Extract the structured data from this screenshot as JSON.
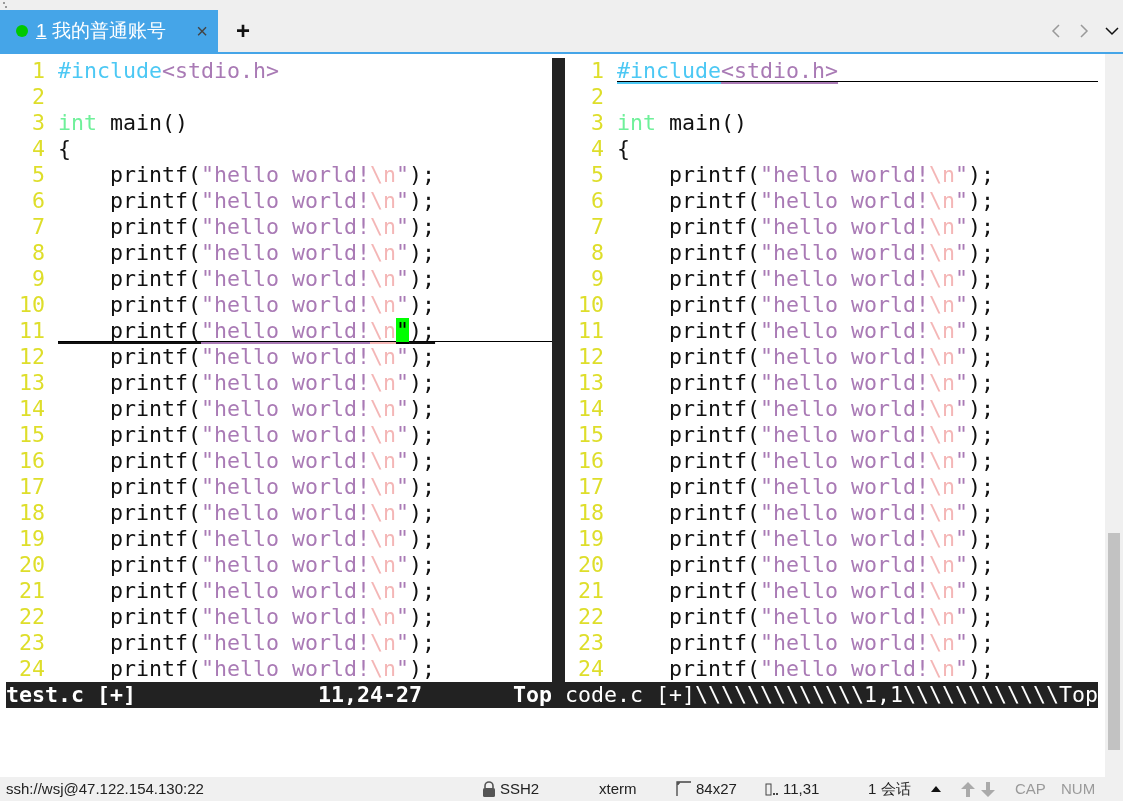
{
  "tabs": [
    {
      "number": "1",
      "label": "我的普通账号",
      "selected": true,
      "connected": true,
      "close": "×"
    }
  ],
  "new_tab": "+",
  "panes": [
    {
      "lines": [
        {
          "number": "1",
          "tokens": [
            {
              "kind": "preproc",
              "text": "#include"
            },
            {
              "kind": "string",
              "text": "<stdio.h>"
            }
          ]
        },
        {
          "number": "2"
        },
        {
          "number": "3",
          "tokens": [
            {
              "kind": "type",
              "text": "int"
            },
            {
              "kind": "plain",
              "text": " main()"
            }
          ]
        },
        {
          "number": "4",
          "tokens": [
            {
              "kind": "plain",
              "text": "{"
            }
          ]
        },
        {
          "number": "5",
          "tokens": [
            {
              "kind": "plain",
              "text": "    printf("
            },
            {
              "kind": "string",
              "text": "\"hello world!"
            },
            {
              "kind": "escape",
              "text": "\\n"
            },
            {
              "kind": "string",
              "text": "\""
            },
            {
              "kind": "plain",
              "text": ");"
            }
          ]
        },
        {
          "number": "6",
          "tokens": [
            {
              "kind": "plain",
              "text": "    printf("
            },
            {
              "kind": "string",
              "text": "\"hello world!"
            },
            {
              "kind": "escape",
              "text": "\\n"
            },
            {
              "kind": "string",
              "text": "\""
            },
            {
              "kind": "plain",
              "text": ");"
            }
          ]
        },
        {
          "number": "7",
          "tokens": [
            {
              "kind": "plain",
              "text": "    printf("
            },
            {
              "kind": "string",
              "text": "\"hello world!"
            },
            {
              "kind": "escape",
              "text": "\\n"
            },
            {
              "kind": "string",
              "text": "\""
            },
            {
              "kind": "plain",
              "text": ");"
            }
          ]
        },
        {
          "number": "8",
          "tokens": [
            {
              "kind": "plain",
              "text": "    printf("
            },
            {
              "kind": "string",
              "text": "\"hello world!"
            },
            {
              "kind": "escape",
              "text": "\\n"
            },
            {
              "kind": "string",
              "text": "\""
            },
            {
              "kind": "plain",
              "text": ");"
            }
          ]
        },
        {
          "number": "9",
          "tokens": [
            {
              "kind": "plain",
              "text": "    printf("
            },
            {
              "kind": "string",
              "text": "\"hello world!"
            },
            {
              "kind": "escape",
              "text": "\\n"
            },
            {
              "kind": "string",
              "text": "\""
            },
            {
              "kind": "plain",
              "text": ");"
            }
          ]
        },
        {
          "number": "10",
          "tokens": [
            {
              "kind": "plain",
              "text": "    printf("
            },
            {
              "kind": "string",
              "text": "\"hello world!"
            },
            {
              "kind": "escape",
              "text": "\\n"
            },
            {
              "kind": "string",
              "text": "\""
            },
            {
              "kind": "plain",
              "text": ");"
            }
          ]
        },
        {
          "number": "11",
          "cursor_line": true,
          "tokens": [
            {
              "kind": "plain",
              "text": "    printf("
            },
            {
              "kind": "string",
              "text": "\"hello world!"
            },
            {
              "kind": "escape",
              "text": "\\n"
            },
            {
              "kind": "string",
              "text": "\"",
              "cursor": true
            },
            {
              "kind": "plain",
              "text": ");"
            }
          ]
        },
        {
          "number": "12",
          "tokens": [
            {
              "kind": "plain",
              "text": "    printf("
            },
            {
              "kind": "string",
              "text": "\"hello world!"
            },
            {
              "kind": "escape",
              "text": "\\n"
            },
            {
              "kind": "string",
              "text": "\""
            },
            {
              "kind": "plain",
              "text": ");"
            }
          ]
        },
        {
          "number": "13",
          "tokens": [
            {
              "kind": "plain",
              "text": "    printf("
            },
            {
              "kind": "string",
              "text": "\"hello world!"
            },
            {
              "kind": "escape",
              "text": "\\n"
            },
            {
              "kind": "string",
              "text": "\""
            },
            {
              "kind": "plain",
              "text": ");"
            }
          ]
        },
        {
          "number": "14",
          "tokens": [
            {
              "kind": "plain",
              "text": "    printf("
            },
            {
              "kind": "string",
              "text": "\"hello world!"
            },
            {
              "kind": "escape",
              "text": "\\n"
            },
            {
              "kind": "string",
              "text": "\""
            },
            {
              "kind": "plain",
              "text": ");"
            }
          ]
        },
        {
          "number": "15",
          "tokens": [
            {
              "kind": "plain",
              "text": "    printf("
            },
            {
              "kind": "string",
              "text": "\"hello world!"
            },
            {
              "kind": "escape",
              "text": "\\n"
            },
            {
              "kind": "string",
              "text": "\""
            },
            {
              "kind": "plain",
              "text": ");"
            }
          ]
        },
        {
          "number": "16",
          "tokens": [
            {
              "kind": "plain",
              "text": "    printf("
            },
            {
              "kind": "string",
              "text": "\"hello world!"
            },
            {
              "kind": "escape",
              "text": "\\n"
            },
            {
              "kind": "string",
              "text": "\""
            },
            {
              "kind": "plain",
              "text": ");"
            }
          ]
        },
        {
          "number": "17",
          "tokens": [
            {
              "kind": "plain",
              "text": "    printf("
            },
            {
              "kind": "string",
              "text": "\"hello world!"
            },
            {
              "kind": "escape",
              "text": "\\n"
            },
            {
              "kind": "string",
              "text": "\""
            },
            {
              "kind": "plain",
              "text": ");"
            }
          ]
        },
        {
          "number": "18",
          "tokens": [
            {
              "kind": "plain",
              "text": "    printf("
            },
            {
              "kind": "string",
              "text": "\"hello world!"
            },
            {
              "kind": "escape",
              "text": "\\n"
            },
            {
              "kind": "string",
              "text": "\""
            },
            {
              "kind": "plain",
              "text": ");"
            }
          ]
        },
        {
          "number": "19",
          "tokens": [
            {
              "kind": "plain",
              "text": "    printf("
            },
            {
              "kind": "string",
              "text": "\"hello world!"
            },
            {
              "kind": "escape",
              "text": "\\n"
            },
            {
              "kind": "string",
              "text": "\""
            },
            {
              "kind": "plain",
              "text": ");"
            }
          ]
        },
        {
          "number": "20",
          "tokens": [
            {
              "kind": "plain",
              "text": "    printf("
            },
            {
              "kind": "string",
              "text": "\"hello world!"
            },
            {
              "kind": "escape",
              "text": "\\n"
            },
            {
              "kind": "string",
              "text": "\""
            },
            {
              "kind": "plain",
              "text": ");"
            }
          ]
        },
        {
          "number": "21",
          "tokens": [
            {
              "kind": "plain",
              "text": "    printf("
            },
            {
              "kind": "string",
              "text": "\"hello world!"
            },
            {
              "kind": "escape",
              "text": "\\n"
            },
            {
              "kind": "string",
              "text": "\""
            },
            {
              "kind": "plain",
              "text": ");"
            }
          ]
        },
        {
          "number": "22",
          "tokens": [
            {
              "kind": "plain",
              "text": "    printf("
            },
            {
              "kind": "string",
              "text": "\"hello world!"
            },
            {
              "kind": "escape",
              "text": "\\n"
            },
            {
              "kind": "string",
              "text": "\""
            },
            {
              "kind": "plain",
              "text": ");"
            }
          ]
        },
        {
          "number": "23",
          "tokens": [
            {
              "kind": "plain",
              "text": "    printf("
            },
            {
              "kind": "string",
              "text": "\"hello world!"
            },
            {
              "kind": "escape",
              "text": "\\n"
            },
            {
              "kind": "string",
              "text": "\""
            },
            {
              "kind": "plain",
              "text": ");"
            }
          ]
        },
        {
          "number": "24",
          "tokens": [
            {
              "kind": "plain",
              "text": "    printf("
            },
            {
              "kind": "string",
              "text": "\"hello world!"
            },
            {
              "kind": "escape",
              "text": "\\n"
            },
            {
              "kind": "string",
              "text": "\""
            },
            {
              "kind": "plain",
              "text": ");"
            }
          ]
        }
      ],
      "status": {
        "active": true,
        "file": "test.c [+]",
        "ruler": "11,24-27",
        "position": "Top"
      }
    },
    {
      "lines": [
        {
          "number": "1",
          "cursor_line": true,
          "tokens": [
            {
              "kind": "preproc",
              "text": "#include"
            },
            {
              "kind": "string",
              "text": "<stdio.h>"
            }
          ]
        },
        {
          "number": "2"
        },
        {
          "number": "3",
          "tokens": [
            {
              "kind": "type",
              "text": "int"
            },
            {
              "kind": "plain",
              "text": " main()"
            }
          ]
        },
        {
          "number": "4",
          "tokens": [
            {
              "kind": "plain",
              "text": "{"
            }
          ]
        },
        {
          "number": "5",
          "tokens": [
            {
              "kind": "plain",
              "text": "    printf("
            },
            {
              "kind": "string",
              "text": "\"hello world!"
            },
            {
              "kind": "escape",
              "text": "\\n"
            },
            {
              "kind": "string",
              "text": "\""
            },
            {
              "kind": "plain",
              "text": ");"
            }
          ]
        },
        {
          "number": "6",
          "tokens": [
            {
              "kind": "plain",
              "text": "    printf("
            },
            {
              "kind": "string",
              "text": "\"hello world!"
            },
            {
              "kind": "escape",
              "text": "\\n"
            },
            {
              "kind": "string",
              "text": "\""
            },
            {
              "kind": "plain",
              "text": ");"
            }
          ]
        },
        {
          "number": "7",
          "tokens": [
            {
              "kind": "plain",
              "text": "    printf("
            },
            {
              "kind": "string",
              "text": "\"hello world!"
            },
            {
              "kind": "escape",
              "text": "\\n"
            },
            {
              "kind": "string",
              "text": "\""
            },
            {
              "kind": "plain",
              "text": ");"
            }
          ]
        },
        {
          "number": "8",
          "tokens": [
            {
              "kind": "plain",
              "text": "    printf("
            },
            {
              "kind": "string",
              "text": "\"hello world!"
            },
            {
              "kind": "escape",
              "text": "\\n"
            },
            {
              "kind": "string",
              "text": "\""
            },
            {
              "kind": "plain",
              "text": ");"
            }
          ]
        },
        {
          "number": "9",
          "tokens": [
            {
              "kind": "plain",
              "text": "    printf("
            },
            {
              "kind": "string",
              "text": "\"hello world!"
            },
            {
              "kind": "escape",
              "text": "\\n"
            },
            {
              "kind": "string",
              "text": "\""
            },
            {
              "kind": "plain",
              "text": ");"
            }
          ]
        },
        {
          "number": "10",
          "tokens": [
            {
              "kind": "plain",
              "text": "    printf("
            },
            {
              "kind": "string",
              "text": "\"hello world!"
            },
            {
              "kind": "escape",
              "text": "\\n"
            },
            {
              "kind": "string",
              "text": "\""
            },
            {
              "kind": "plain",
              "text": ");"
            }
          ]
        },
        {
          "number": "11",
          "tokens": [
            {
              "kind": "plain",
              "text": "    printf("
            },
            {
              "kind": "string",
              "text": "\"hello world!"
            },
            {
              "kind": "escape",
              "text": "\\n"
            },
            {
              "kind": "string",
              "text": "\""
            },
            {
              "kind": "plain",
              "text": ");"
            }
          ]
        },
        {
          "number": "12",
          "tokens": [
            {
              "kind": "plain",
              "text": "    printf("
            },
            {
              "kind": "string",
              "text": "\"hello world!"
            },
            {
              "kind": "escape",
              "text": "\\n"
            },
            {
              "kind": "string",
              "text": "\""
            },
            {
              "kind": "plain",
              "text": ");"
            }
          ]
        },
        {
          "number": "13",
          "tokens": [
            {
              "kind": "plain",
              "text": "    printf("
            },
            {
              "kind": "string",
              "text": "\"hello world!"
            },
            {
              "kind": "escape",
              "text": "\\n"
            },
            {
              "kind": "string",
              "text": "\""
            },
            {
              "kind": "plain",
              "text": ");"
            }
          ]
        },
        {
          "number": "14",
          "tokens": [
            {
              "kind": "plain",
              "text": "    printf("
            },
            {
              "kind": "string",
              "text": "\"hello world!"
            },
            {
              "kind": "escape",
              "text": "\\n"
            },
            {
              "kind": "string",
              "text": "\""
            },
            {
              "kind": "plain",
              "text": ");"
            }
          ]
        },
        {
          "number": "15",
          "tokens": [
            {
              "kind": "plain",
              "text": "    printf("
            },
            {
              "kind": "string",
              "text": "\"hello world!"
            },
            {
              "kind": "escape",
              "text": "\\n"
            },
            {
              "kind": "string",
              "text": "\""
            },
            {
              "kind": "plain",
              "text": ");"
            }
          ]
        },
        {
          "number": "16",
          "tokens": [
            {
              "kind": "plain",
              "text": "    printf("
            },
            {
              "kind": "string",
              "text": "\"hello world!"
            },
            {
              "kind": "escape",
              "text": "\\n"
            },
            {
              "kind": "string",
              "text": "\""
            },
            {
              "kind": "plain",
              "text": ");"
            }
          ]
        },
        {
          "number": "17",
          "tokens": [
            {
              "kind": "plain",
              "text": "    printf("
            },
            {
              "kind": "string",
              "text": "\"hello world!"
            },
            {
              "kind": "escape",
              "text": "\\n"
            },
            {
              "kind": "string",
              "text": "\""
            },
            {
              "kind": "plain",
              "text": ");"
            }
          ]
        },
        {
          "number": "18",
          "tokens": [
            {
              "kind": "plain",
              "text": "    printf("
            },
            {
              "kind": "string",
              "text": "\"hello world!"
            },
            {
              "kind": "escape",
              "text": "\\n"
            },
            {
              "kind": "string",
              "text": "\""
            },
            {
              "kind": "plain",
              "text": ");"
            }
          ]
        },
        {
          "number": "19",
          "tokens": [
            {
              "kind": "plain",
              "text": "    printf("
            },
            {
              "kind": "string",
              "text": "\"hello world!"
            },
            {
              "kind": "escape",
              "text": "\\n"
            },
            {
              "kind": "string",
              "text": "\""
            },
            {
              "kind": "plain",
              "text": ");"
            }
          ]
        },
        {
          "number": "20",
          "tokens": [
            {
              "kind": "plain",
              "text": "    printf("
            },
            {
              "kind": "string",
              "text": "\"hello world!"
            },
            {
              "kind": "escape",
              "text": "\\n"
            },
            {
              "kind": "string",
              "text": "\""
            },
            {
              "kind": "plain",
              "text": ");"
            }
          ]
        },
        {
          "number": "21",
          "tokens": [
            {
              "kind": "plain",
              "text": "    printf("
            },
            {
              "kind": "string",
              "text": "\"hello world!"
            },
            {
              "kind": "escape",
              "text": "\\n"
            },
            {
              "kind": "string",
              "text": "\""
            },
            {
              "kind": "plain",
              "text": ");"
            }
          ]
        },
        {
          "number": "22",
          "tokens": [
            {
              "kind": "plain",
              "text": "    printf("
            },
            {
              "kind": "string",
              "text": "\"hello world!"
            },
            {
              "kind": "escape",
              "text": "\\n"
            },
            {
              "kind": "string",
              "text": "\""
            },
            {
              "kind": "plain",
              "text": ");"
            }
          ]
        },
        {
          "number": "23",
          "tokens": [
            {
              "kind": "plain",
              "text": "    printf("
            },
            {
              "kind": "string",
              "text": "\"hello world!"
            },
            {
              "kind": "escape",
              "text": "\\n"
            },
            {
              "kind": "string",
              "text": "\""
            },
            {
              "kind": "plain",
              "text": ");"
            }
          ]
        },
        {
          "number": "24",
          "tokens": [
            {
              "kind": "plain",
              "text": "    printf("
            },
            {
              "kind": "string",
              "text": "\"hello world!"
            },
            {
              "kind": "escape",
              "text": "\\n"
            },
            {
              "kind": "string",
              "text": "\""
            },
            {
              "kind": "plain",
              "text": ");"
            }
          ]
        }
      ],
      "status": {
        "active": false,
        "file": "code.c [+]",
        "fill_before_ruler": "\\\\\\\\\\\\\\\\\\\\\\\\\\",
        "ruler": "1,1",
        "fill_before_position": "\\\\\\\\\\\\\\\\\\\\\\\\",
        "position": "Top"
      }
    }
  ],
  "status_bar": {
    "address": "ssh://wsj@47.122.154.130:22",
    "protocol": "SSH2",
    "terminal": "xterm",
    "size": "84x27",
    "cursor": "11,31",
    "sessions": "1 会话",
    "keys": [
      {
        "label": "CAP",
        "on": false
      },
      {
        "label": "NUM",
        "on": false
      }
    ]
  }
}
